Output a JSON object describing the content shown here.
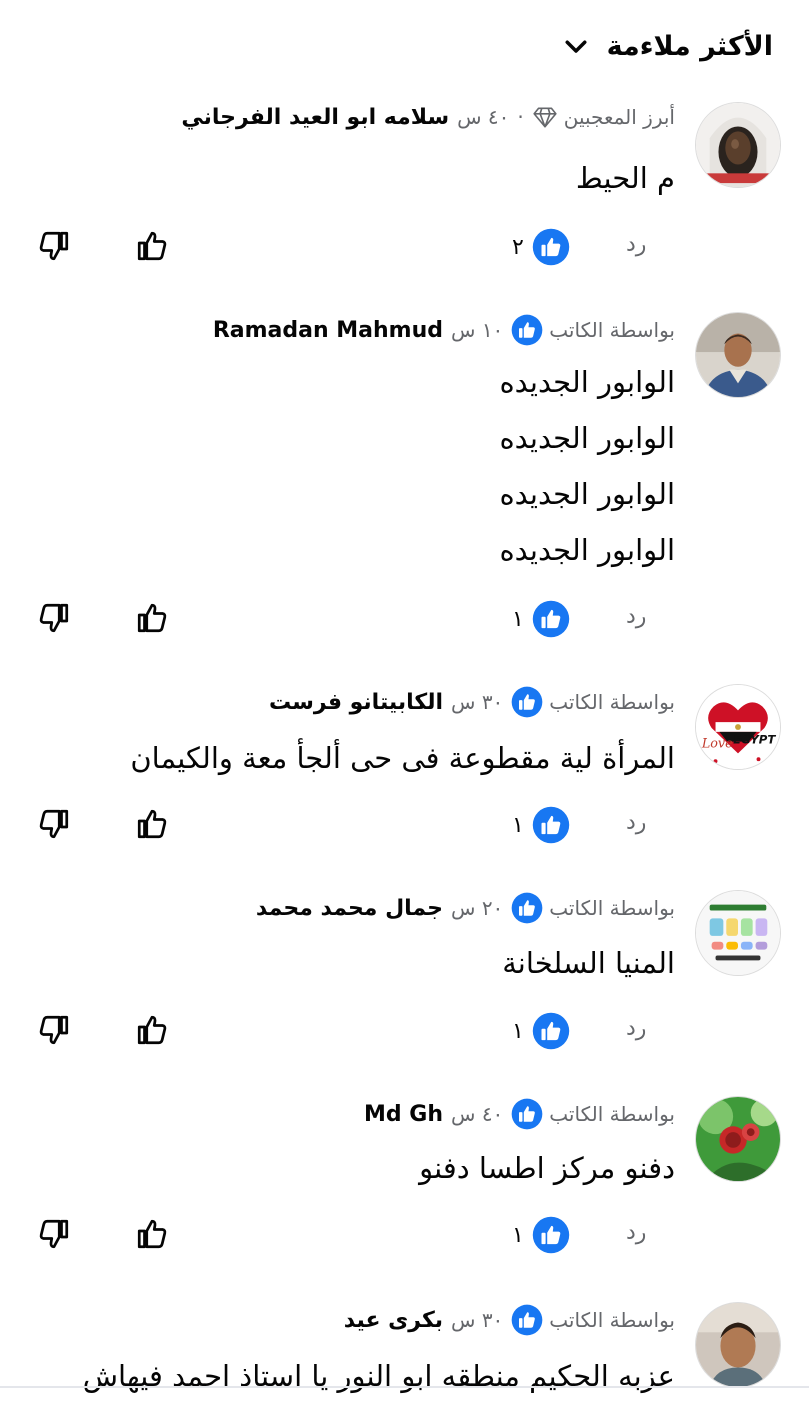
{
  "sort": {
    "label": "الأكثر ملاءمة"
  },
  "comments": [
    {
      "author": "سلامه ابو العيد الفرجاني",
      "time": "٤٠ س",
      "badge": "أبرز المعجبين",
      "lines": [
        "م الحيط"
      ],
      "reactions": "٢",
      "reply_label": "رد"
    },
    {
      "author": "Ramadan Mahmud",
      "time": "١٠ س",
      "badge": "بواسطة الكاتب",
      "lines": [
        "الوابور الجديده",
        "الوابور الجديده",
        "الوابور الجديده",
        "الوابور الجديده"
      ],
      "reactions": "١",
      "reply_label": "رد"
    },
    {
      "author": "الكابيتانو فرست",
      "time": "٣٠ س",
      "badge": "بواسطة الكاتب",
      "lines": [
        "المرأة لية مقطوعة فى حى ألجأ معة والكيمان"
      ],
      "reactions": "١",
      "reply_label": "رد",
      "avatar_text": [
        "Love",
        "EGYPT"
      ]
    },
    {
      "author": "جمال محمد محمد",
      "time": "٢٠ س",
      "badge": "بواسطة الكاتب",
      "lines": [
        "المنيا السلخانة"
      ],
      "reactions": "١",
      "reply_label": "رد"
    },
    {
      "author": "Md Gh",
      "time": "٤٠ س",
      "badge": "بواسطة الكاتب",
      "lines": [
        "دفنو مركز اطسا دفنو"
      ],
      "reactions": "١",
      "reply_label": "رد"
    },
    {
      "author": "بكرى عيد",
      "time": "٣٠ س",
      "badge": "بواسطة الكاتب",
      "lines": [
        "عزبه الحكيم منطقه ابو النور يا استاذ احمد فيهاش"
      ]
    }
  ],
  "colors": {
    "accent": "#1877f2",
    "secondary_text": "#65676b",
    "primary_text": "#050505"
  },
  "icons": [
    "chevron-down-icon",
    "diamond-icon",
    "author-like-icon",
    "like-reaction-icon",
    "like-icon",
    "dislike-icon"
  ]
}
